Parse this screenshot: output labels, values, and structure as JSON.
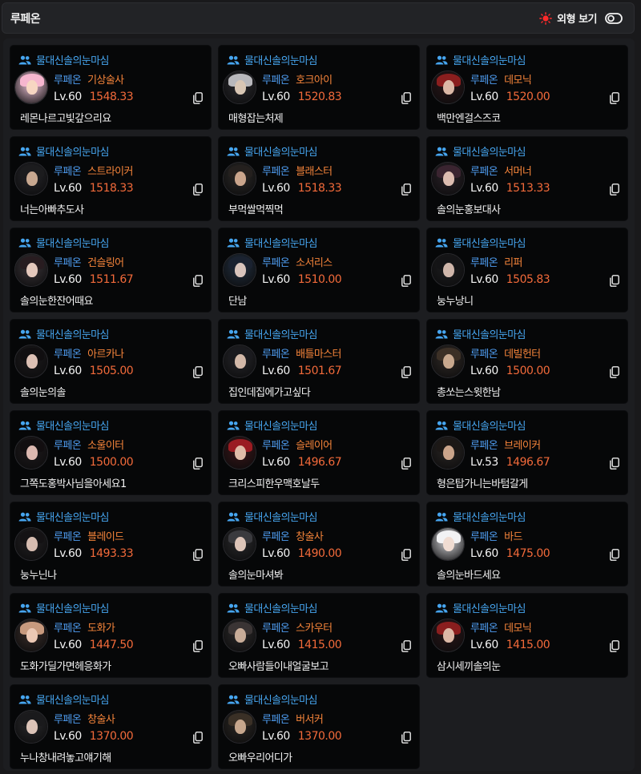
{
  "header": {
    "title": "루페온",
    "toggle_label": "외형 보기",
    "accent_color": "#ff2a2a"
  },
  "cards": [
    {
      "guild": "물대신솔의눈마심",
      "server": "루페온",
      "class": "기상술사",
      "level": "Lv.60",
      "item_level": "1548.33",
      "name": "레몬나르고빛갚으리요",
      "avatar_tone": [
        "#f0c4d8",
        "#f7d6c2",
        "#f6b6cf"
      ]
    },
    {
      "guild": "물대신솔의눈마심",
      "server": "루페온",
      "class": "호크아이",
      "level": "Lv.60",
      "item_level": "1520.83",
      "name": "매형잡는처제",
      "avatar_tone": [
        "#2a2a2e",
        "#d8c6b4",
        "#b8b8bc"
      ]
    },
    {
      "guild": "물대신솔의눈마심",
      "server": "루페온",
      "class": "데모닉",
      "level": "Lv.60",
      "item_level": "1520.00",
      "name": "백만엔걸스즈코",
      "avatar_tone": [
        "#2a1618",
        "#dcb8a6",
        "#8a1e1e"
      ]
    },
    {
      "guild": "물대신솔의눈마심",
      "server": "루페온",
      "class": "스트라이커",
      "level": "Lv.60",
      "item_level": "1518.33",
      "name": "너는아빠추도사",
      "avatar_tone": [
        "#26262a",
        "#c8a890",
        "#1c1c1e"
      ]
    },
    {
      "guild": "물대신솔의눈마심",
      "server": "루페온",
      "class": "블래스터",
      "level": "Lv.60",
      "item_level": "1518.33",
      "name": "부먹쌀먹찍먹",
      "avatar_tone": [
        "#2c2a28",
        "#caa58c",
        "#24201e"
      ]
    },
    {
      "guild": "물대신솔의눈마심",
      "server": "루페온",
      "class": "서머너",
      "level": "Lv.60",
      "item_level": "1513.33",
      "name": "솔의눈홍보대사",
      "avatar_tone": [
        "#2a2228",
        "#dcbcb0",
        "#3a2430"
      ]
    },
    {
      "guild": "물대신솔의눈마심",
      "server": "루페온",
      "class": "건슬링어",
      "level": "Lv.60",
      "item_level": "1511.67",
      "name": "솔의눈한잔어때요",
      "avatar_tone": [
        "#3a3438",
        "#e4c8bc",
        "#281c20"
      ]
    },
    {
      "guild": "물대신솔의눈마심",
      "server": "루페온",
      "class": "소서리스",
      "level": "Lv.60",
      "item_level": "1510.00",
      "name": "단남",
      "avatar_tone": [
        "#223040",
        "#d8c4bc",
        "#1a2230"
      ]
    },
    {
      "guild": "물대신솔의눈마심",
      "server": "루페온",
      "class": "리퍼",
      "level": "Lv.60",
      "item_level": "1505.83",
      "name": "눙누낭니",
      "avatar_tone": [
        "#1e1e20",
        "#cfb6aa",
        "#141416"
      ]
    },
    {
      "guild": "물대신솔의눈마심",
      "server": "루페온",
      "class": "아르카나",
      "level": "Lv.60",
      "item_level": "1505.00",
      "name": "솔의눈의솔",
      "avatar_tone": [
        "#1c1a1c",
        "#dcc0b4",
        "#100e10"
      ]
    },
    {
      "guild": "물대신솔의눈마심",
      "server": "루페온",
      "class": "배틀마스터",
      "level": "Lv.60",
      "item_level": "1501.67",
      "name": "집인데집에가고싶다",
      "avatar_tone": [
        "#26262a",
        "#d2b8a8",
        "#1a1a1e"
      ]
    },
    {
      "guild": "물대신솔의눈마심",
      "server": "루페온",
      "class": "데빌헌터",
      "level": "Lv.60",
      "item_level": "1500.00",
      "name": "총쏘는스윗한남",
      "avatar_tone": [
        "#302a26",
        "#c8a88e",
        "#3c3026"
      ]
    },
    {
      "guild": "물대신솔의눈마심",
      "server": "루페온",
      "class": "소울이터",
      "level": "Lv.60",
      "item_level": "1500.00",
      "name": "그쪽도홍박사님을아세요1",
      "avatar_tone": [
        "#1e1a1c",
        "#dcb8b0",
        "#120e10"
      ]
    },
    {
      "guild": "물대신솔의눈마심",
      "server": "루페온",
      "class": "슬레이어",
      "level": "Lv.60",
      "item_level": "1496.67",
      "name": "크리스피한우맥호날두",
      "avatar_tone": [
        "#3a1618",
        "#e0bca8",
        "#9a1c22"
      ]
    },
    {
      "guild": "물대신솔의눈마심",
      "server": "루페온",
      "class": "브레이커",
      "level": "Lv.53",
      "item_level": "1496.67",
      "name": "형은탑가니는바텀갈게",
      "avatar_tone": [
        "#2a2624",
        "#caa48a",
        "#1c1816"
      ]
    },
    {
      "guild": "물대신솔의눈마심",
      "server": "루페온",
      "class": "블레이드",
      "level": "Lv.60",
      "item_level": "1493.33",
      "name": "눙누닌나",
      "avatar_tone": [
        "#222022",
        "#d6bcb0",
        "#141214"
      ]
    },
    {
      "guild": "물대신솔의눈마심",
      "server": "루페온",
      "class": "창술사",
      "level": "Lv.60",
      "item_level": "1490.00",
      "name": "솔의눈마셔봐",
      "avatar_tone": [
        "#2a2a2c",
        "#dcc4b8",
        "#3a3a3e"
      ]
    },
    {
      "guild": "물대신솔의눈마심",
      "server": "루페온",
      "class": "바드",
      "level": "Lv.60",
      "item_level": "1475.00",
      "name": "솔의눈바드세요",
      "avatar_tone": [
        "#d8d8dc",
        "#f0dcd2",
        "#f2f2f4"
      ]
    },
    {
      "guild": "물대신솔의눈마심",
      "server": "루페온",
      "class": "도화가",
      "level": "Lv.60",
      "item_level": "1447.50",
      "name": "도화가딜가면헤응화가",
      "avatar_tone": [
        "#3a2e2a",
        "#ecc8b4",
        "#c89a7e"
      ]
    },
    {
      "guild": "물대신솔의눈마심",
      "server": "루페온",
      "class": "스카우터",
      "level": "Lv.60",
      "item_level": "1415.00",
      "name": "오빠사람들이내얼굴보고",
      "avatar_tone": [
        "#2c2a2a",
        "#c8ac98",
        "#3a3434"
      ]
    },
    {
      "guild": "물대신솔의눈마심",
      "server": "루페온",
      "class": "데모닉",
      "level": "Lv.60",
      "item_level": "1415.00",
      "name": "삼시세끼솔의눈",
      "avatar_tone": [
        "#2a1618",
        "#dcb8a6",
        "#8a1e1e"
      ]
    },
    {
      "guild": "물대신솔의눈마심",
      "server": "루페온",
      "class": "창술사",
      "level": "Lv.60",
      "item_level": "1370.00",
      "name": "누나창내려놓고얘기해",
      "avatar_tone": [
        "#2a2a2c",
        "#dcc4b8",
        "#1a1a1c"
      ]
    },
    {
      "guild": "물대신솔의눈마심",
      "server": "루페온",
      "class": "버서커",
      "level": "Lv.60",
      "item_level": "1370.00",
      "name": "오빠우리어디가",
      "avatar_tone": [
        "#2c2824",
        "#c6a68c",
        "#3a3026"
      ]
    }
  ]
}
